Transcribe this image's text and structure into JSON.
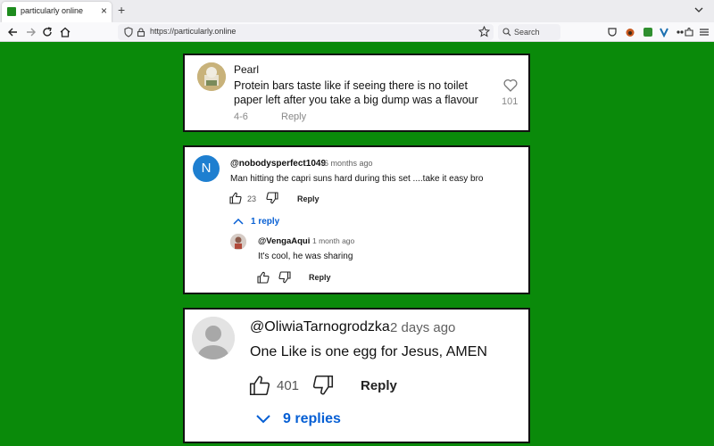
{
  "browser": {
    "tab_title": "particularly online",
    "url": "https://particularly.online",
    "search_placeholder": "Search"
  },
  "comments": [
    {
      "author": "Pearl",
      "text_line1": "Protein bars taste like if seeing there is no toilet",
      "text_line2": "paper left after you take a big dump was a flavour",
      "date": "4-6",
      "reply_label": "Reply",
      "likes": "101"
    },
    {
      "avatar_letter": "N",
      "author": "@nobodysperfect1049",
      "time": "6 months ago",
      "text": "Man hitting the capri suns hard during this set ....take it easy bro",
      "likes": "23",
      "reply_label": "Reply",
      "replies_toggle": "1 reply",
      "reply": {
        "author": "@VengaAqui",
        "time": "1 month ago",
        "text": "It's cool, he was sharing",
        "reply_label": "Reply"
      }
    },
    {
      "author": "@OliwiaTarnogrodzka",
      "time": "2 days ago",
      "text": "One Like is one egg for Jesus, AMEN",
      "likes": "401",
      "reply_label": "Reply",
      "replies_toggle": "9 replies"
    }
  ],
  "colors": {
    "page_background": "#0a8a0a",
    "link_blue": "#065fd4",
    "avatar_n": "#1e7fd0"
  }
}
